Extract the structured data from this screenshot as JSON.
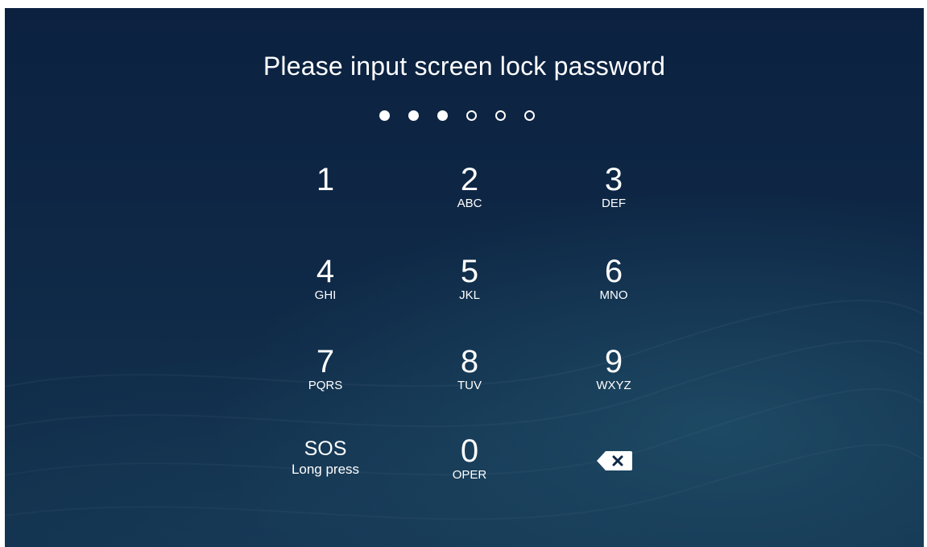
{
  "lock_screen": {
    "title": "Please input screen lock password",
    "pin_length": 6,
    "pin_entered": 3
  },
  "keypad": {
    "keys": [
      {
        "digit": "1",
        "letters": ""
      },
      {
        "digit": "2",
        "letters": "ABC"
      },
      {
        "digit": "3",
        "letters": "DEF"
      },
      {
        "digit": "4",
        "letters": "GHI"
      },
      {
        "digit": "5",
        "letters": "JKL"
      },
      {
        "digit": "6",
        "letters": "MNO"
      },
      {
        "digit": "7",
        "letters": "PQRS"
      },
      {
        "digit": "8",
        "letters": "TUV"
      },
      {
        "digit": "9",
        "letters": "WXYZ"
      },
      {
        "digit": "0",
        "letters": "OPER"
      }
    ],
    "sos": {
      "label": "SOS",
      "hint": "Long press"
    },
    "backspace_icon": "backspace-icon"
  },
  "colors": {
    "background_top": "#0c2140",
    "background_bottom": "#13334f",
    "foreground": "#ffffff"
  }
}
